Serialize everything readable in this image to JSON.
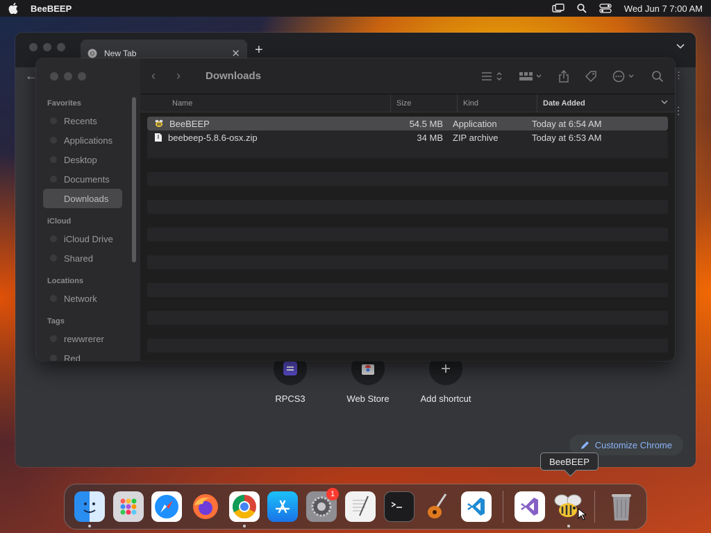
{
  "menubar": {
    "app_name": "BeeBEEP",
    "clock": "Wed Jun 7  7:00 AM"
  },
  "chrome": {
    "tab_title": "New Tab",
    "shortcuts": [
      {
        "label": "RPCS3"
      },
      {
        "label": "Web Store"
      },
      {
        "label": "Add shortcut"
      }
    ],
    "customize_label": "Customize Chrome"
  },
  "finder": {
    "path": "Downloads",
    "sidebar": {
      "favorites_header": "Favorites",
      "favorites": [
        "Recents",
        "Applications",
        "Desktop",
        "Documents",
        "Downloads"
      ],
      "icloud_header": "iCloud",
      "icloud": [
        "iCloud Drive",
        "Shared"
      ],
      "locations_header": "Locations",
      "locations": [
        "Network"
      ],
      "tags_header": "Tags",
      "tags": [
        "rewwrerer",
        "Red"
      ]
    },
    "columns": {
      "name": "Name",
      "size": "Size",
      "kind": "Kind",
      "date": "Date Added"
    },
    "files": [
      {
        "name": "BeeBEEP",
        "size": "54.5 MB",
        "kind": "Application",
        "date": "Today at 6:54 AM"
      },
      {
        "name": "beebeep-5.8.6-osx.zip",
        "size": "34 MB",
        "kind": "ZIP archive",
        "date": "Today at 6:53 AM"
      }
    ]
  },
  "tooltip": "BeeBEEP",
  "dock": {
    "apps": [
      "finder-icon",
      "launchpad-icon",
      "safari-icon",
      "firefox-icon",
      "chrome-icon",
      "app-store-icon",
      "system-settings-icon",
      "textedit-icon",
      "terminal-icon",
      "garageband-icon",
      "vscode-icon",
      "visual-studio-icon",
      "beebeep-icon",
      "trash-icon"
    ],
    "settings_badge": "1"
  }
}
